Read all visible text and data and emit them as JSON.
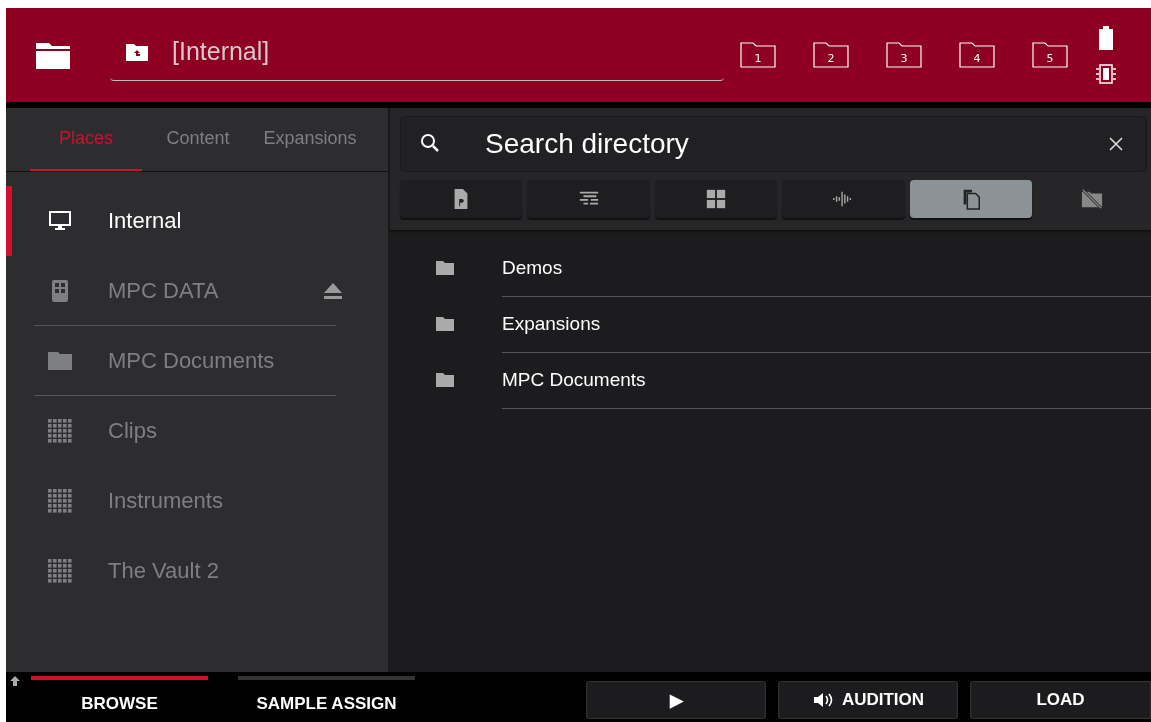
{
  "header": {
    "path": "[Internal]",
    "quick_folders": [
      "1",
      "2",
      "3",
      "4",
      "5"
    ]
  },
  "place_tabs": [
    {
      "label": "Places",
      "selected": true
    },
    {
      "label": "Content",
      "selected": false
    },
    {
      "label": "Expansions",
      "selected": false
    }
  ],
  "places": [
    {
      "label": "Internal",
      "kind": "device",
      "selected": true,
      "ejectable": false,
      "divider_after": false
    },
    {
      "label": "MPC DATA",
      "kind": "drive",
      "selected": false,
      "ejectable": true,
      "divider_after": true
    },
    {
      "label": "MPC Documents",
      "kind": "folder",
      "selected": false,
      "ejectable": false,
      "divider_after": true
    },
    {
      "label": "Clips",
      "kind": "pack",
      "selected": false,
      "ejectable": false,
      "divider_after": false
    },
    {
      "label": "Instruments",
      "kind": "pack",
      "selected": false,
      "ejectable": false,
      "divider_after": false
    },
    {
      "label": "The Vault 2",
      "kind": "pack",
      "selected": false,
      "ejectable": false,
      "divider_after": false
    }
  ],
  "search": {
    "placeholder": "Search directory"
  },
  "filters": [
    {
      "kind": "program",
      "selected": false
    },
    {
      "kind": "sequence",
      "selected": false
    },
    {
      "kind": "grid",
      "selected": false
    },
    {
      "kind": "audio",
      "selected": false
    },
    {
      "kind": "all",
      "selected": true
    },
    {
      "kind": "hide-mpc",
      "selected": false
    }
  ],
  "files": [
    {
      "name": "Demos"
    },
    {
      "name": "Expansions"
    },
    {
      "name": "MPC Documents"
    }
  ],
  "mode_tabs": [
    {
      "label": "BROWSE",
      "selected": true
    },
    {
      "label": "SAMPLE ASSIGN",
      "selected": false
    }
  ],
  "actions": [
    {
      "kind": "play",
      "label": "▶"
    },
    {
      "kind": "audition",
      "label": "AUDITION"
    },
    {
      "kind": "load",
      "label": "LOAD"
    }
  ]
}
